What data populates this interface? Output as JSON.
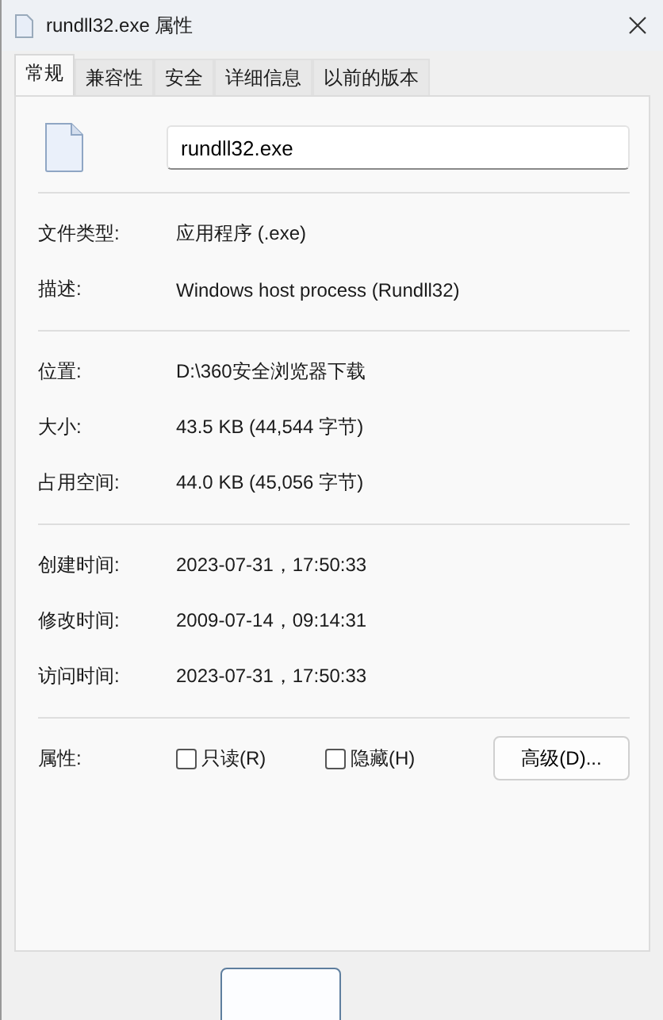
{
  "window": {
    "title": "rundll32.exe 属性"
  },
  "tabs": [
    {
      "label": "常规",
      "selected": true
    },
    {
      "label": "兼容性",
      "selected": false
    },
    {
      "label": "安全",
      "selected": false
    },
    {
      "label": "详细信息",
      "selected": false
    },
    {
      "label": "以前的版本",
      "selected": false
    }
  ],
  "file_name": {
    "value": "rundll32.exe"
  },
  "sections": [
    [
      {
        "label": "文件类型:",
        "value": "应用程序 (.exe)"
      },
      {
        "label": "描述:",
        "value": "Windows host process (Rundll32)"
      }
    ],
    [
      {
        "label": "位置:",
        "value": "D:\\360安全浏览器下载"
      },
      {
        "label": "大小:",
        "value": "43.5 KB (44,544 字节)"
      },
      {
        "label": "占用空间:",
        "value": "44.0 KB (45,056 字节)"
      }
    ],
    [
      {
        "label": "创建时间:",
        "value": "2023-07-31，17:50:33"
      },
      {
        "label": "修改时间:",
        "value": "2009-07-14，09:14:31"
      },
      {
        "label": "访问时间:",
        "value": "2023-07-31，17:50:33"
      }
    ]
  ],
  "attributes": {
    "label": "属性:",
    "checkboxes": [
      {
        "label": "只读(R)",
        "checked": false
      },
      {
        "label": "隐藏(H)",
        "checked": false
      }
    ],
    "button": "高级(D)..."
  }
}
